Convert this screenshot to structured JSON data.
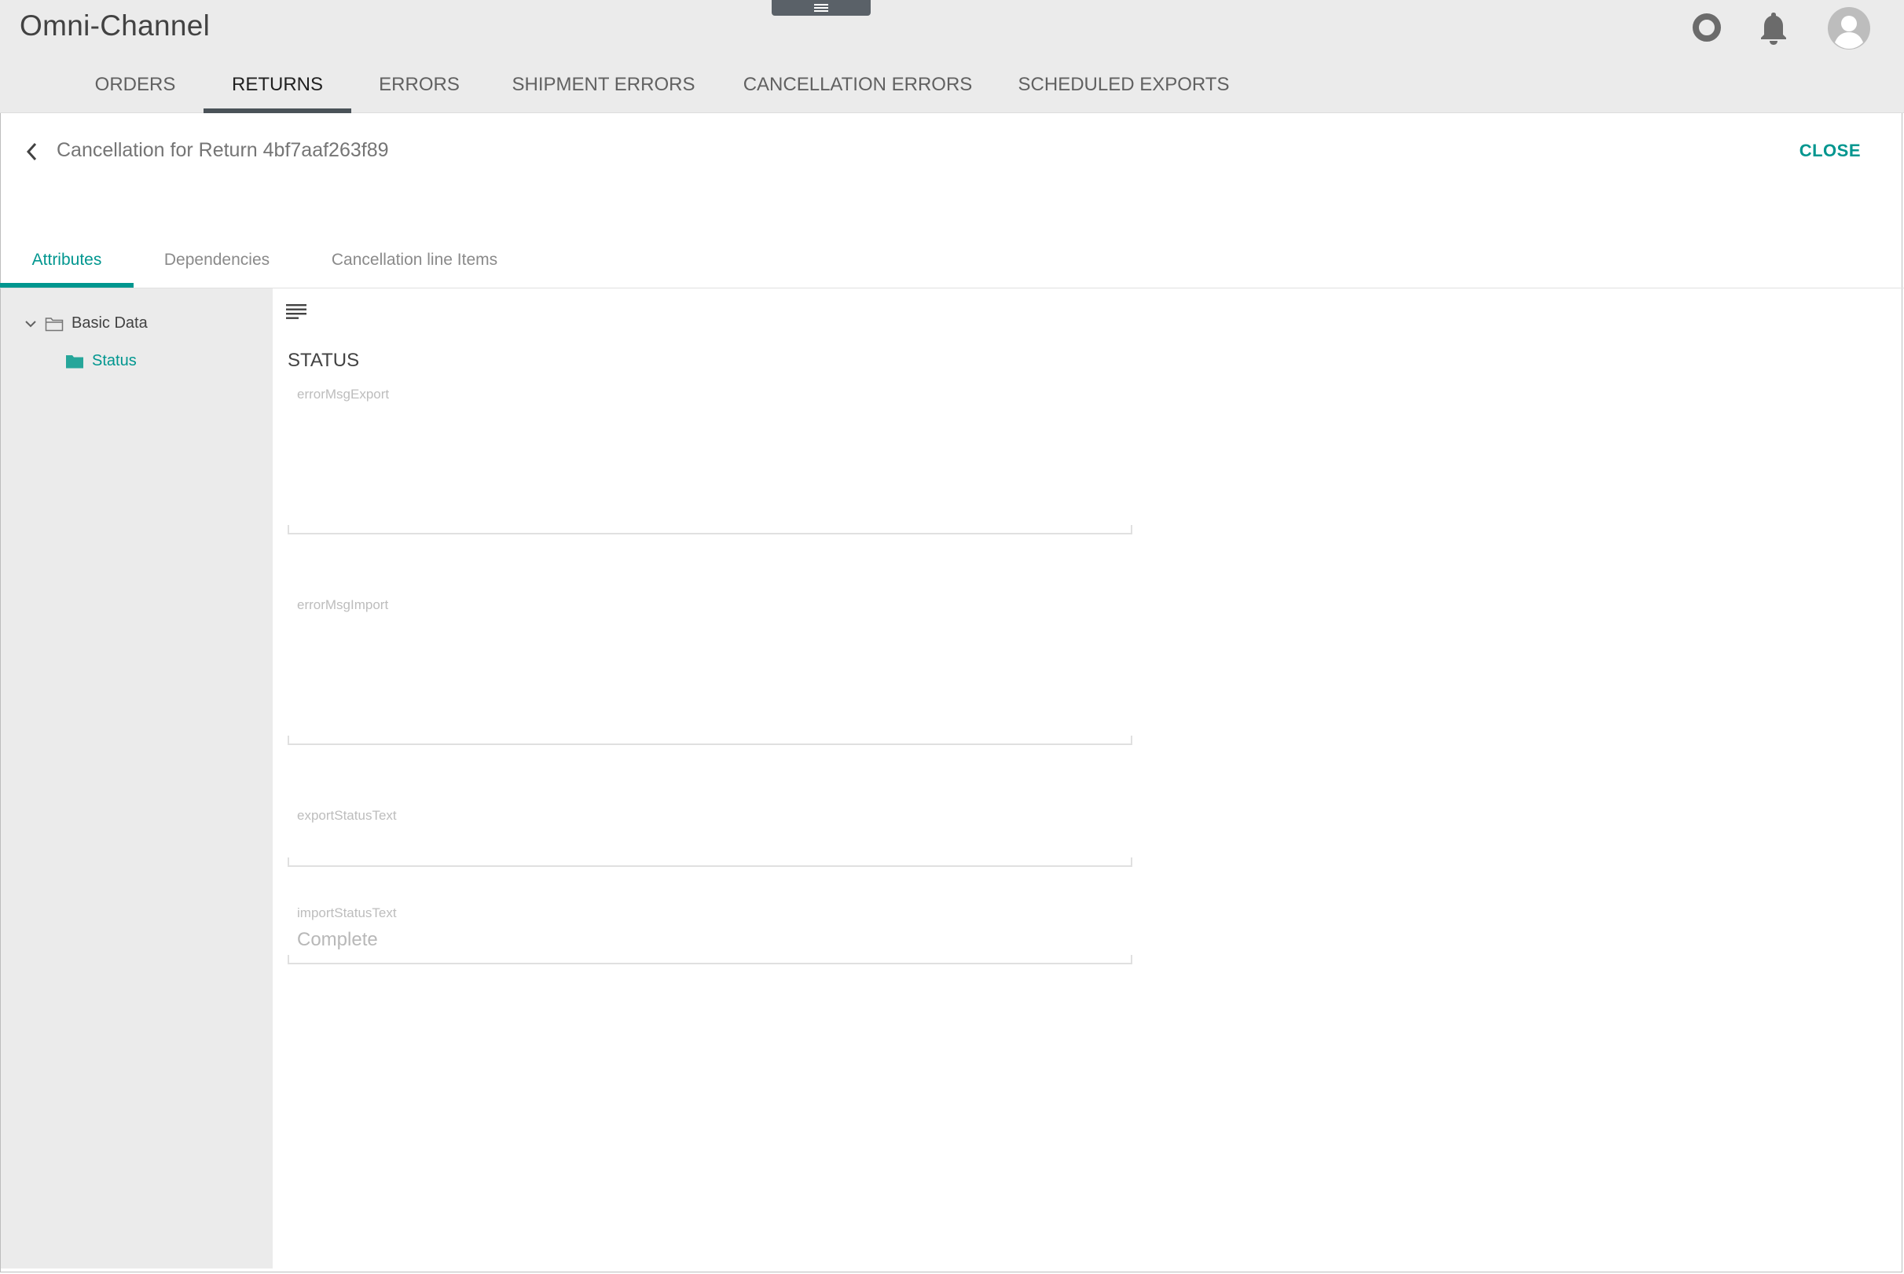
{
  "app": {
    "title": "Omni-Channel"
  },
  "header_icons": {
    "help": "help-ring-icon",
    "notifications": "bell-icon",
    "profile": "avatar-icon",
    "grip": "menu-grip-icon"
  },
  "nav": {
    "tabs": [
      {
        "label": "ORDERS"
      },
      {
        "label": "RETURNS"
      },
      {
        "label": "ERRORS"
      },
      {
        "label": "SHIPMENT ERRORS"
      },
      {
        "label": "CANCELLATION ERRORS"
      },
      {
        "label": "SCHEDULED EXPORTS"
      }
    ],
    "active": "RETURNS"
  },
  "detail": {
    "title": "Cancellation for Return 4bf7aaf263f89",
    "close_label": "CLOSE"
  },
  "subtabs": {
    "items": [
      {
        "label": "Attributes"
      },
      {
        "label": "Dependencies"
      },
      {
        "label": "Cancellation line Items"
      }
    ],
    "active": "Attributes"
  },
  "tree": {
    "root": {
      "label": "Basic Data"
    },
    "child": {
      "label": "Status"
    }
  },
  "section": {
    "title": "STATUS",
    "fields": [
      {
        "label": "errorMsgExport",
        "value": ""
      },
      {
        "label": "errorMsgImport",
        "value": ""
      },
      {
        "label": "exportStatusText",
        "value": ""
      },
      {
        "label": "importStatusText",
        "value": "Complete"
      }
    ]
  },
  "colors": {
    "accent": "#00968f",
    "header_bg": "#ebebeb",
    "nav_underline": "#4a5258"
  }
}
